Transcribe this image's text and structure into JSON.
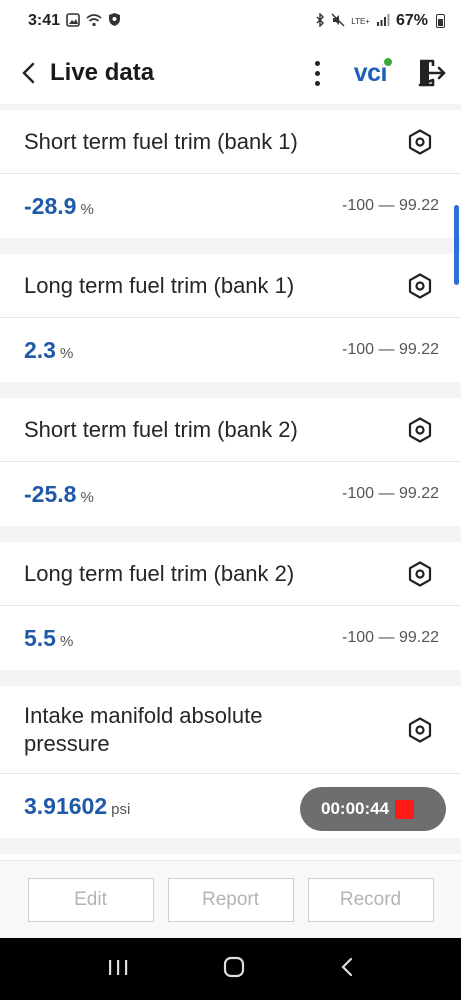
{
  "status": {
    "time": "3:41",
    "network": "LTE+",
    "battery": "67%"
  },
  "header": {
    "title": "Live data",
    "vci_label": "vci",
    "colors": {
      "accent": "#1f5fb8",
      "vci_dot": "#3ba83b"
    }
  },
  "items": [
    {
      "name": "Short term fuel trim (bank 1)",
      "value": "-28.9",
      "unit": "%",
      "range": "-100 — 99.22"
    },
    {
      "name": "Long term fuel trim (bank 1)",
      "value": "2.3",
      "unit": "%",
      "range": "-100 — 99.22"
    },
    {
      "name": "Short term fuel trim (bank 2)",
      "value": "-25.8",
      "unit": "%",
      "range": "-100 — 99.22"
    },
    {
      "name": "Long term fuel trim (bank 2)",
      "value": "5.5",
      "unit": "%",
      "range": "-100 — 99.22"
    },
    {
      "name": "Intake manifold absolute pressure",
      "value": "3.91602",
      "unit": "psi",
      "range": ""
    }
  ],
  "recording": {
    "timer": "00:00:44",
    "rec_color": "#ff1a1a"
  },
  "actions": {
    "edit": "Edit",
    "report": "Report",
    "record": "Record"
  },
  "icons": {
    "back": "chevron-left-icon",
    "menu": "kebab-icon",
    "exit": "exit-icon",
    "settings": "settings-hexagon-icon"
  }
}
